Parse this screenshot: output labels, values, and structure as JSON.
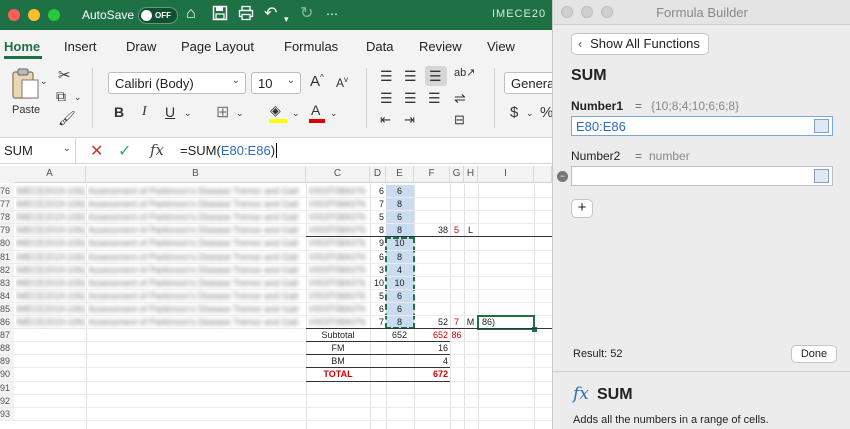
{
  "titlebar": {
    "autosave_label": "AutoSave",
    "autosave_state": "OFF",
    "workbook_title": "IMECE20"
  },
  "ribbon": {
    "tabs": [
      "Home",
      "Insert",
      "Draw",
      "Page Layout",
      "Formulas",
      "Data",
      "Review",
      "View"
    ],
    "active_tab": "Home",
    "paste_label": "Paste",
    "font_name": "Calibri (Body)",
    "font_size": "10",
    "number_format": "General",
    "accent_color": "#1e7145"
  },
  "formula_bar": {
    "name_box": "SUM",
    "formula_prefix": "=SUM(",
    "formula_ref": "E80:E86",
    "formula_suffix": ")"
  },
  "grid": {
    "columns": [
      "A",
      "B",
      "C",
      "D",
      "E",
      "F",
      "G",
      "H",
      "I"
    ],
    "rows": [
      {
        "num": "76",
        "d": "6",
        "e": "6",
        "f": "",
        "g": "",
        "h": "",
        "i": ""
      },
      {
        "num": "77",
        "d": "7",
        "e": "8",
        "f": "",
        "g": "",
        "h": "",
        "i": ""
      },
      {
        "num": "78",
        "d": "5",
        "e": "6",
        "f": "",
        "g": "",
        "h": "",
        "i": ""
      },
      {
        "num": "79",
        "d": "8",
        "e": "8",
        "f": "38",
        "g": "5",
        "h": "L",
        "i": ""
      },
      {
        "num": "80",
        "d": "9",
        "e": "10",
        "f": "",
        "g": "",
        "h": "",
        "i": ""
      },
      {
        "num": "81",
        "d": "6",
        "e": "8",
        "f": "",
        "g": "",
        "h": "",
        "i": ""
      },
      {
        "num": "82",
        "d": "3",
        "e": "4",
        "f": "",
        "g": "",
        "h": "",
        "i": ""
      },
      {
        "num": "83",
        "d": "10",
        "e": "10",
        "f": "",
        "g": "",
        "h": "",
        "i": ""
      },
      {
        "num": "84",
        "d": "5",
        "e": "6",
        "f": "",
        "g": "",
        "h": "",
        "i": ""
      },
      {
        "num": "85",
        "d": "6",
        "e": "6",
        "f": "",
        "g": "",
        "h": "",
        "i": ""
      },
      {
        "num": "86",
        "d": "7",
        "e": "8",
        "f": "52",
        "g": "7",
        "h": "M",
        "i": "86)"
      },
      {
        "num": "87",
        "c": "Subtotal",
        "d": "",
        "e": "652",
        "f": "652",
        "g": "86",
        "h": "",
        "i": ""
      },
      {
        "num": "88",
        "c": "FM",
        "d": "",
        "e": "",
        "f": "16",
        "g": "",
        "h": "",
        "i": ""
      },
      {
        "num": "89",
        "c": "BM",
        "d": "",
        "e": "",
        "f": "4",
        "g": "",
        "h": "",
        "i": ""
      },
      {
        "num": "90",
        "c": "TOTAL",
        "d": "",
        "e": "",
        "f": "672",
        "g": "",
        "h": "",
        "i": ""
      },
      {
        "num": "91",
        "d": "",
        "e": "",
        "f": "",
        "g": "",
        "h": "",
        "i": ""
      },
      {
        "num": "92",
        "d": "",
        "e": "",
        "f": "",
        "g": "",
        "h": "",
        "i": ""
      },
      {
        "num": "93",
        "d": "",
        "e": "",
        "f": "",
        "g": "",
        "h": "",
        "i": ""
      }
    ],
    "blurred_a": "IMECE2019-1062 Assessment",
    "blurred_b": "Assessment of Parkinson's Disease Tremor and Gait",
    "blurred_c": "V003T08A076",
    "selection_fill": "#c9dcf0",
    "red_color": "#cc0000"
  },
  "formula_builder": {
    "window_title": "Formula Builder",
    "show_all_label": "Show All Functions",
    "function_name": "SUM",
    "number1_label": "Number1",
    "number1_preview": "{10;8;4;10;6;6;8}",
    "number1_value": "E80:E86",
    "number2_label": "Number2",
    "number2_placeholder": "number",
    "equals": "=",
    "result_label": "Result: 52",
    "done_label": "Done",
    "fx_title": "SUM",
    "description": "Adds all the numbers in a range of cells."
  }
}
